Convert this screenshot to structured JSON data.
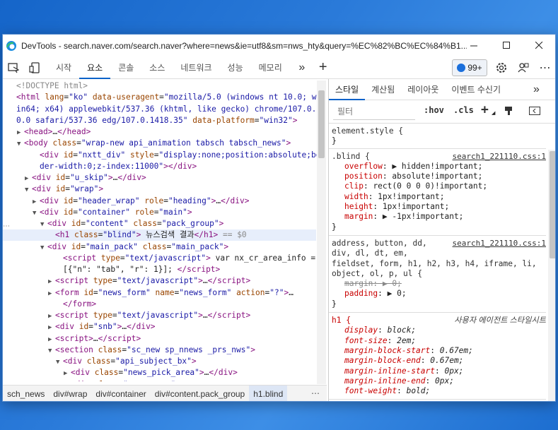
{
  "window": {
    "title": "DevTools - search.naver.com/search.naver?where=news&ie=utf8&sm=nws_hty&query=%EC%82%BC%EC%84%B1..."
  },
  "toolbar": {
    "tabs": [
      "시작",
      "요소",
      "콘솔",
      "소스",
      "네트워크",
      "성능",
      "메모리"
    ],
    "active_tab": "요소",
    "issues_badge": "99+"
  },
  "dom_lines": [
    {
      "indent": 0,
      "arrow": "",
      "html": "<span class='cm'>&lt;!DOCTYPE html&gt;</span>"
    },
    {
      "indent": 0,
      "arrow": "",
      "html": "<span class='tg'>&lt;html</span> <span class='an'>lang</span>=<span class='av'>\"ko\"</span> <span class='an'>data-useragent</span>=<span class='av'>\"mozilla/5.0 (windows nt 10.0; w</span>"
    },
    {
      "indent": 0,
      "arrow": "",
      "html": "<span class='av'>in64; x64) applewebkit/537.36 (khtml, like gecko) chrome/107.0.</span>"
    },
    {
      "indent": 0,
      "arrow": "",
      "html": "<span class='av'>0.0 safari/537.36 edg/107.0.1418.35\"</span> <span class='an'>data-platform</span>=<span class='av'>\"win32\"</span><span class='tg'>&gt;</span>"
    },
    {
      "indent": 1,
      "arrow": "▶",
      "html": "<span class='tg'>&lt;head&gt;</span>…<span class='tg'>&lt;/head&gt;</span>"
    },
    {
      "indent": 1,
      "arrow": "▼",
      "html": "<span class='tg'>&lt;body</span> <span class='an'>class</span>=<span class='av'>\"wrap-new api_animation tabsch tabsch_news\"</span><span class='tg'>&gt;</span>"
    },
    {
      "indent": 3,
      "arrow": "",
      "html": "<span class='tg'>&lt;div</span> <span class='an'>id</span>=<span class='av'>\"nxtt_div\"</span> <span class='an'>style</span>=<span class='av'>\"display:none;position:absolute;bor</span>"
    },
    {
      "indent": 3,
      "arrow": "",
      "html": "<span class='av'>der-width:0;z-index:11000\"</span><span class='tg'>&gt;&lt;/div&gt;</span>"
    },
    {
      "indent": 2,
      "arrow": "▶",
      "html": "<span class='tg'>&lt;div</span> <span class='an'>id</span>=<span class='av'>\"u_skip\"</span><span class='tg'>&gt;</span>…<span class='tg'>&lt;/div&gt;</span>"
    },
    {
      "indent": 2,
      "arrow": "▼",
      "html": "<span class='tg'>&lt;div</span> <span class='an'>id</span>=<span class='av'>\"wrap\"</span><span class='tg'>&gt;</span>"
    },
    {
      "indent": 3,
      "arrow": "▶",
      "html": "<span class='tg'>&lt;div</span> <span class='an'>id</span>=<span class='av'>\"header_wrap\"</span> <span class='an'>role</span>=<span class='av'>\"heading\"</span><span class='tg'>&gt;</span>…<span class='tg'>&lt;/div&gt;</span>"
    },
    {
      "indent": 3,
      "arrow": "▼",
      "html": "<span class='tg'>&lt;div</span> <span class='an'>id</span>=<span class='av'>\"container\"</span> <span class='an'>role</span>=<span class='av'>\"main\"</span><span class='tg'>&gt;</span>"
    },
    {
      "indent": 4,
      "arrow": "▼",
      "html": "<span class='tg'>&lt;div</span> <span class='an'>id</span>=<span class='av'>\"content\"</span> <span class='an'>class</span>=<span class='av'>\"pack_group\"</span><span class='tg'>&gt;</span>"
    },
    {
      "indent": 5,
      "arrow": "",
      "hl": true,
      "html": "<span class='tg'>&lt;h1</span> <span class='an'>class</span>=<span class='av'>\"blind\"</span><span class='tg'>&gt;</span> 뉴스검색 결과<span class='tg'>&lt;/h1&gt;</span> <span class='cm'>== $0</span>"
    },
    {
      "indent": 4,
      "arrow": "▼",
      "html": "<span class='tg'>&lt;div</span> <span class='an'>id</span>=<span class='av'>\"main_pack\"</span> <span class='an'>class</span>=<span class='av'>\"main_pack\"</span><span class='tg'>&gt;</span>"
    },
    {
      "indent": 6,
      "arrow": "",
      "html": "<span class='tg'>&lt;script</span> <span class='an'>type</span>=<span class='av'>\"text/javascript\"</span><span class='tg'>&gt;</span> var nx_cr_area_info ="
    },
    {
      "indent": 6,
      "arrow": "",
      "html": "[{\"n\": \"tab\", \"r\": 1}]; <span class='tg'>&lt;/script&gt;</span>"
    },
    {
      "indent": 5,
      "arrow": "▶",
      "html": "<span class='tg'>&lt;script</span> <span class='an'>type</span>=<span class='av'>\"text/javascript\"</span><span class='tg'>&gt;</span>…<span class='tg'>&lt;/script&gt;</span>"
    },
    {
      "indent": 5,
      "arrow": "▶",
      "html": "<span class='tg'>&lt;form</span> <span class='an'>id</span>=<span class='av'>\"news_form\"</span> <span class='an'>name</span>=<span class='av'>\"news_form\"</span> <span class='an'>action</span>=<span class='av'>\"?\"</span><span class='tg'>&gt;</span>…"
    },
    {
      "indent": 6,
      "arrow": "",
      "html": "<span class='tg'>&lt;/form&gt;</span>"
    },
    {
      "indent": 5,
      "arrow": "▶",
      "html": "<span class='tg'>&lt;script</span> <span class='an'>type</span>=<span class='av'>\"text/javascript\"</span><span class='tg'>&gt;</span>…<span class='tg'>&lt;/script&gt;</span>"
    },
    {
      "indent": 5,
      "arrow": "▶",
      "html": "<span class='tg'>&lt;div</span> <span class='an'>id</span>=<span class='av'>\"snb\"</span><span class='tg'>&gt;</span>…<span class='tg'>&lt;/div&gt;</span>"
    },
    {
      "indent": 5,
      "arrow": "▶",
      "html": "<span class='tg'>&lt;script&gt;</span>…<span class='tg'>&lt;/script&gt;</span>"
    },
    {
      "indent": 5,
      "arrow": "▼",
      "html": "<span class='tg'>&lt;section</span> <span class='an'>class</span>=<span class='av'>\"sc_new sp_nnews _prs_nws\"</span><span class='tg'>&gt;</span>"
    },
    {
      "indent": 6,
      "arrow": "▼",
      "html": "<span class='tg'>&lt;div</span> <span class='an'>class</span>=<span class='av'>\"api_subject_bx\"</span><span class='tg'>&gt;</span>"
    },
    {
      "indent": 7,
      "arrow": "▶",
      "html": "<span class='tg'>&lt;div</span> <span class='an'>class</span>=<span class='av'>\"news_pick_area\"</span><span class='tg'>&gt;</span>…<span class='tg'>&lt;/div&gt;</span>"
    },
    {
      "indent": 7,
      "arrow": "▶",
      "html": "<span class='tg'>&lt;div</span> <span class='an'>class</span>=<span class='av'>\"group_nav\"</span><span class='tg'>&gt;</span>…"
    }
  ],
  "breadcrumbs": [
    "sch_news",
    "div#wrap",
    "div#container",
    "div#content.pack_group",
    "h1.blind"
  ],
  "styles_tabs": [
    "스타일",
    "계산됨",
    "레이아웃",
    "이벤트 수신기"
  ],
  "filter_placeholder": "필터",
  "hov_label": ":hov",
  "cls_label": ".cls",
  "rules": [
    {
      "selector": "element.style {",
      "source": "",
      "decls": [],
      "close": "}"
    },
    {
      "selector": ".blind {",
      "source": "search1_221110.css:1",
      "decls": [
        {
          "p": "overflow",
          "v": "▶ hidden!important;"
        },
        {
          "p": "position",
          "v": "absolute!important;"
        },
        {
          "p": "clip",
          "v": "rect(0 0 0 0)!important;"
        },
        {
          "p": "width",
          "v": "1px!important;"
        },
        {
          "p": "height",
          "v": "1px!important;"
        },
        {
          "p": "margin",
          "v": "▶ -1px!important;"
        }
      ],
      "close": "}"
    },
    {
      "selector": "address, button, dd,",
      "selector2": "div, dl, dt, em,",
      "selector3": "fieldset, form, h1, h2, h3, h4, iframe, li,",
      "selector4": "object, ol, p, ul {",
      "source": "search1_221110.css:1",
      "decls": [
        {
          "p": "margin",
          "v": "▶ 0;",
          "strike": true
        },
        {
          "p": "padding",
          "v": "▶ 0;"
        }
      ],
      "close": "}"
    },
    {
      "selector": "h1 {",
      "source": "사용자 에이전트 스타일시트",
      "ua": true,
      "decls": [
        {
          "p": "display",
          "v": "block;"
        },
        {
          "p": "font-size",
          "v": "2em;"
        },
        {
          "p": "margin-block-start",
          "v": "0.67em;"
        },
        {
          "p": "margin-block-end",
          "v": "0.67em;"
        },
        {
          "p": "margin-inline-start",
          "v": "0px;"
        },
        {
          "p": "margin-inline-end",
          "v": "0px;"
        },
        {
          "p": "font-weight",
          "v": "bold;"
        }
      ],
      "close": ""
    }
  ]
}
